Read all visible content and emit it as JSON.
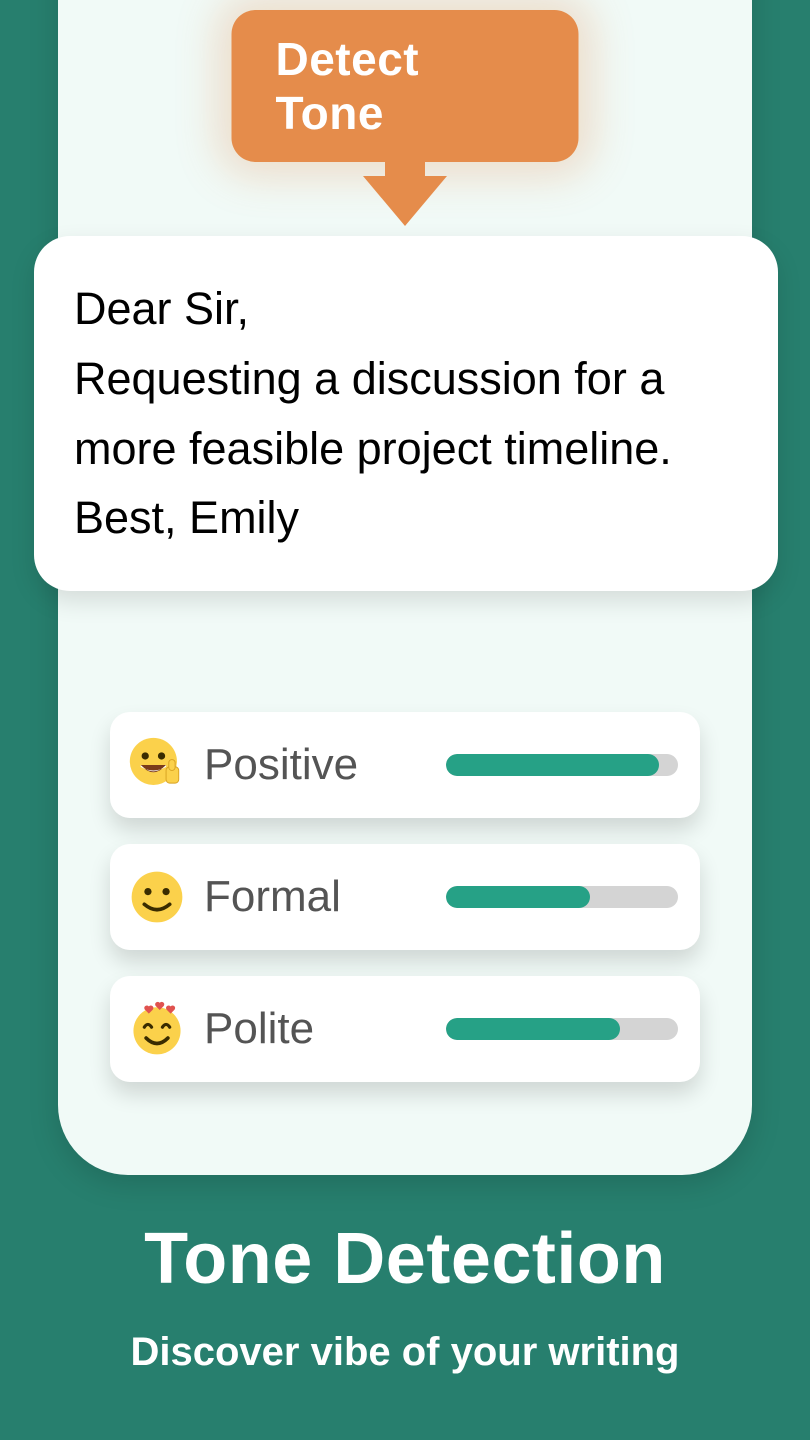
{
  "button": {
    "label": "Detect Tone"
  },
  "message": {
    "lines": [
      "Dear Sir,",
      "Requesting a discussion for a more feasible project timeline.",
      "Best, Emily"
    ]
  },
  "tones": [
    {
      "icon": "happy-thumbs-icon",
      "label": "Positive",
      "value": 92
    },
    {
      "icon": "smile-icon",
      "label": "Formal",
      "value": 62
    },
    {
      "icon": "hearts-face-icon",
      "label": "Polite",
      "value": 75
    }
  ],
  "footer": {
    "title": "Tone Detection",
    "subtitle": "Discover vibe of your writing"
  },
  "colors": {
    "accent": "#e58c4b",
    "brand": "#277f6e",
    "bar": "#26a186"
  }
}
